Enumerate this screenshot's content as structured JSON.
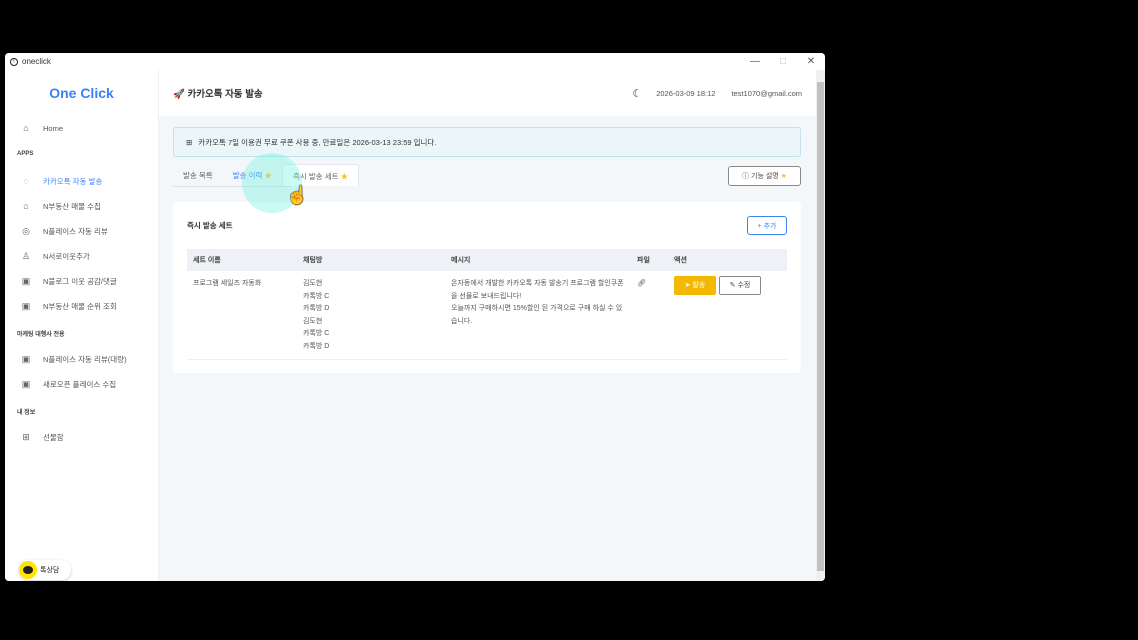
{
  "window": {
    "title": "oneclick",
    "minimize": "—",
    "maximize": "□",
    "close": "✕"
  },
  "sidebar": {
    "logo": "One Click",
    "home": "Home",
    "sections": [
      "APPS",
      "마케팅 대행사 전용",
      "내 정보"
    ],
    "apps": [
      "카카오톡 자동 발송",
      "N부동산 매물 수집",
      "N플레이스 자동 리뷰",
      "N서로이웃추가",
      "N블로그 이웃 공감/댓글",
      "N부동산 매물 순위 조회"
    ],
    "agency": [
      "N플레이스 자동 리뷰(대량)",
      "새로오픈 플레이스 수집"
    ],
    "my": [
      "선물함"
    ],
    "kakao_chat": "톡상담"
  },
  "header": {
    "title": "카카오톡 자동 발송",
    "datetime": "2026-03-09 18:12",
    "email": "test1070@gmail.com"
  },
  "alert": "카카오톡 7일 이용권 무료 쿠폰 사용 중, 만료일은 2026-03-13 23:59 입니다.",
  "tabs": [
    "발송 목록",
    "발송 이력",
    "즉시 발송 세트"
  ],
  "help_button": "기능 설명",
  "card": {
    "title": "즉시 발송 세트",
    "add_button": "+ 추가",
    "columns": [
      "세트 이름",
      "채팅방",
      "메시지",
      "파일",
      "액션"
    ],
    "rows": [
      {
        "name": "프로그램 세일즈 자동화",
        "rooms": [
          "김도현",
          "카톡방 C",
          "카톡방 D",
          "김도현",
          "카톡방 C",
          "카톡방 D"
        ],
        "message": [
          "온자동에서 개발한 카카오톡 자동 발송기 프로그램 할인쿠폰을 선물로 보내드립니다!",
          "오늘까지 구매하시면 15%할인 된 가격으로 구매 하실 수 있습니다."
        ],
        "send": "발송",
        "edit": "수정"
      }
    ]
  }
}
